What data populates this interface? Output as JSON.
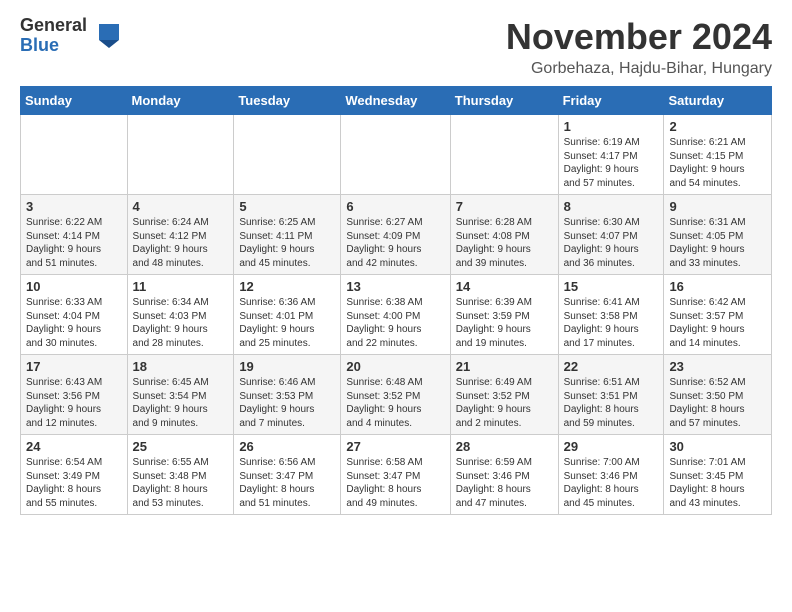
{
  "header": {
    "logo_line1": "General",
    "logo_line2": "Blue",
    "month_title": "November 2024",
    "location": "Gorbehaza, Hajdu-Bihar, Hungary"
  },
  "weekdays": [
    "Sunday",
    "Monday",
    "Tuesday",
    "Wednesday",
    "Thursday",
    "Friday",
    "Saturday"
  ],
  "weeks": [
    [
      {
        "day": "",
        "info": ""
      },
      {
        "day": "",
        "info": ""
      },
      {
        "day": "",
        "info": ""
      },
      {
        "day": "",
        "info": ""
      },
      {
        "day": "",
        "info": ""
      },
      {
        "day": "1",
        "info": "Sunrise: 6:19 AM\nSunset: 4:17 PM\nDaylight: 9 hours\nand 57 minutes."
      },
      {
        "day": "2",
        "info": "Sunrise: 6:21 AM\nSunset: 4:15 PM\nDaylight: 9 hours\nand 54 minutes."
      }
    ],
    [
      {
        "day": "3",
        "info": "Sunrise: 6:22 AM\nSunset: 4:14 PM\nDaylight: 9 hours\nand 51 minutes."
      },
      {
        "day": "4",
        "info": "Sunrise: 6:24 AM\nSunset: 4:12 PM\nDaylight: 9 hours\nand 48 minutes."
      },
      {
        "day": "5",
        "info": "Sunrise: 6:25 AM\nSunset: 4:11 PM\nDaylight: 9 hours\nand 45 minutes."
      },
      {
        "day": "6",
        "info": "Sunrise: 6:27 AM\nSunset: 4:09 PM\nDaylight: 9 hours\nand 42 minutes."
      },
      {
        "day": "7",
        "info": "Sunrise: 6:28 AM\nSunset: 4:08 PM\nDaylight: 9 hours\nand 39 minutes."
      },
      {
        "day": "8",
        "info": "Sunrise: 6:30 AM\nSunset: 4:07 PM\nDaylight: 9 hours\nand 36 minutes."
      },
      {
        "day": "9",
        "info": "Sunrise: 6:31 AM\nSunset: 4:05 PM\nDaylight: 9 hours\nand 33 minutes."
      }
    ],
    [
      {
        "day": "10",
        "info": "Sunrise: 6:33 AM\nSunset: 4:04 PM\nDaylight: 9 hours\nand 30 minutes."
      },
      {
        "day": "11",
        "info": "Sunrise: 6:34 AM\nSunset: 4:03 PM\nDaylight: 9 hours\nand 28 minutes."
      },
      {
        "day": "12",
        "info": "Sunrise: 6:36 AM\nSunset: 4:01 PM\nDaylight: 9 hours\nand 25 minutes."
      },
      {
        "day": "13",
        "info": "Sunrise: 6:38 AM\nSunset: 4:00 PM\nDaylight: 9 hours\nand 22 minutes."
      },
      {
        "day": "14",
        "info": "Sunrise: 6:39 AM\nSunset: 3:59 PM\nDaylight: 9 hours\nand 19 minutes."
      },
      {
        "day": "15",
        "info": "Sunrise: 6:41 AM\nSunset: 3:58 PM\nDaylight: 9 hours\nand 17 minutes."
      },
      {
        "day": "16",
        "info": "Sunrise: 6:42 AM\nSunset: 3:57 PM\nDaylight: 9 hours\nand 14 minutes."
      }
    ],
    [
      {
        "day": "17",
        "info": "Sunrise: 6:43 AM\nSunset: 3:56 PM\nDaylight: 9 hours\nand 12 minutes."
      },
      {
        "day": "18",
        "info": "Sunrise: 6:45 AM\nSunset: 3:54 PM\nDaylight: 9 hours\nand 9 minutes."
      },
      {
        "day": "19",
        "info": "Sunrise: 6:46 AM\nSunset: 3:53 PM\nDaylight: 9 hours\nand 7 minutes."
      },
      {
        "day": "20",
        "info": "Sunrise: 6:48 AM\nSunset: 3:52 PM\nDaylight: 9 hours\nand 4 minutes."
      },
      {
        "day": "21",
        "info": "Sunrise: 6:49 AM\nSunset: 3:52 PM\nDaylight: 9 hours\nand 2 minutes."
      },
      {
        "day": "22",
        "info": "Sunrise: 6:51 AM\nSunset: 3:51 PM\nDaylight: 8 hours\nand 59 minutes."
      },
      {
        "day": "23",
        "info": "Sunrise: 6:52 AM\nSunset: 3:50 PM\nDaylight: 8 hours\nand 57 minutes."
      }
    ],
    [
      {
        "day": "24",
        "info": "Sunrise: 6:54 AM\nSunset: 3:49 PM\nDaylight: 8 hours\nand 55 minutes."
      },
      {
        "day": "25",
        "info": "Sunrise: 6:55 AM\nSunset: 3:48 PM\nDaylight: 8 hours\nand 53 minutes."
      },
      {
        "day": "26",
        "info": "Sunrise: 6:56 AM\nSunset: 3:47 PM\nDaylight: 8 hours\nand 51 minutes."
      },
      {
        "day": "27",
        "info": "Sunrise: 6:58 AM\nSunset: 3:47 PM\nDaylight: 8 hours\nand 49 minutes."
      },
      {
        "day": "28",
        "info": "Sunrise: 6:59 AM\nSunset: 3:46 PM\nDaylight: 8 hours\nand 47 minutes."
      },
      {
        "day": "29",
        "info": "Sunrise: 7:00 AM\nSunset: 3:46 PM\nDaylight: 8 hours\nand 45 minutes."
      },
      {
        "day": "30",
        "info": "Sunrise: 7:01 AM\nSunset: 3:45 PM\nDaylight: 8 hours\nand 43 minutes."
      }
    ]
  ]
}
